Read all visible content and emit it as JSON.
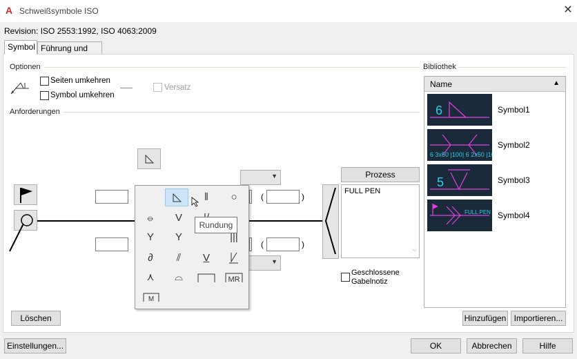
{
  "window": {
    "title": "Schweißsymbole ISO",
    "app_icon": "autocad-a-icon",
    "close_label": "✕"
  },
  "revision": "Revision: ISO 2553:1992, ISO 4063:2009",
  "tabs": [
    {
      "label": "Symbol",
      "active": true
    },
    {
      "label": "Führung und Text",
      "active": false
    }
  ],
  "optionen": {
    "label": "Optionen",
    "seiten_umkehren": {
      "label": "Seiten umkehren",
      "checked": false
    },
    "symbol_umkehren": {
      "label": "Symbol umkehren",
      "checked": false
    },
    "versatz": {
      "label": "Versatz",
      "checked": false,
      "enabled": false
    }
  },
  "anforderungen": {
    "label": "Anforderungen"
  },
  "brackets": {
    "open": "(",
    "close": ")"
  },
  "palette": {
    "tooltip": "Rundung",
    "rows": [
      [
        "",
        "◺",
        "‖",
        "○"
      ],
      [
        "",
        "⦵",
        "V",
        "|/"
      ],
      [
        "",
        "Y",
        "Y",
        "|||"
      ],
      [
        "",
        "∂",
        "⫽",
        "V̲"
      ],
      [
        "",
        "⋏",
        "⌓",
        "⊓"
      ],
      [
        "",
        "M",
        "",
        ""
      ]
    ],
    "mr_label": "MR",
    "m_label": "M"
  },
  "prozess_button": "Prozess hinzufügen...",
  "prozess_text": "FULL PEN",
  "geschlossene_gabelnotiz": {
    "label": "Geschlossene Gabelnotiz",
    "checked": false
  },
  "loeschen_button": "Löschen",
  "bibliothek": {
    "label": "Bibliothek",
    "column_header": "Name",
    "items": [
      {
        "name": "Symbol1",
        "thumb_text": "6"
      },
      {
        "name": "Symbol2",
        "thumb_text": "6  3x50 |100|  6  2x50 |100|"
      },
      {
        "name": "Symbol3",
        "thumb_text": "5"
      },
      {
        "name": "Symbol4",
        "thumb_text": "FULL PEN"
      }
    ],
    "add_button": "Hinzufügen",
    "import_button": "Importieren..."
  },
  "footer": {
    "settings": "Einstellungen...",
    "ok": "OK",
    "cancel": "Abbrechen",
    "help": "Hilfe"
  },
  "colors": {
    "thumb_bg": "#1b2a3a",
    "thumb_magenta": "#e040e0",
    "thumb_cyan": "#28d0e8",
    "hover_bg": "#cce4f7"
  }
}
